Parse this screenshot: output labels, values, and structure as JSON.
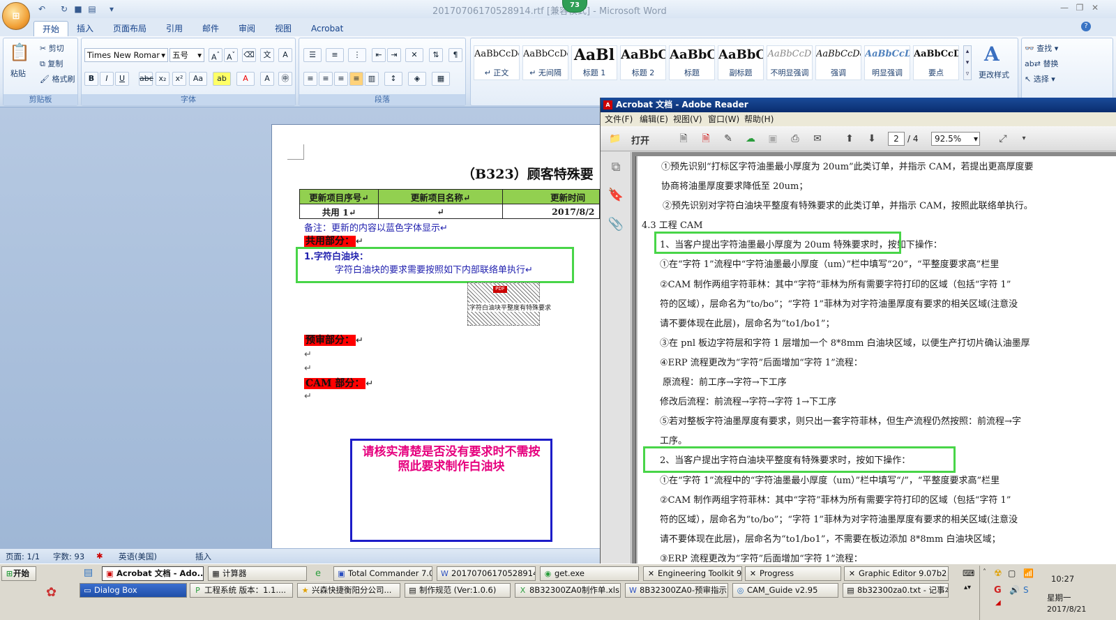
{
  "word": {
    "window_title": "20170706170528914.rtf [兼容模式] - Microsoft Word",
    "counter_badge": "73",
    "tabs": [
      "开始",
      "插入",
      "页面布局",
      "引用",
      "邮件",
      "审阅",
      "视图",
      "Acrobat"
    ],
    "clipboard": {
      "paste": "粘贴",
      "cut": "剪切",
      "copy": "复制",
      "format_painter": "格式刷",
      "label": "剪贴板"
    },
    "font": {
      "name": "Times New Romar",
      "size": "五号",
      "label": "字体"
    },
    "paragraph_label": "段落",
    "styles": [
      {
        "sample": "AaBbCcDc",
        "name": "↵ 正文"
      },
      {
        "sample": "AaBbCcDc",
        "name": "↵ 无间隔"
      },
      {
        "sample": "AaBl",
        "name": "标题 1"
      },
      {
        "sample": "AaBbC",
        "name": "标题 2"
      },
      {
        "sample": "AaBbC",
        "name": "标题"
      },
      {
        "sample": "AaBbC",
        "name": "副标题"
      },
      {
        "sample": "AaBbCcD",
        "name": "不明显强调"
      },
      {
        "sample": "AaBbCcDc",
        "name": "强调"
      },
      {
        "sample": "AaBbCcD",
        "name": "明显强调"
      },
      {
        "sample": "AaBbCcD",
        "name": "要点"
      }
    ],
    "change_styles": "更改样式",
    "editing": {
      "find": "查找",
      "replace": "替换",
      "select": "选择"
    },
    "doc": {
      "heading": "（B323）顾客特殊要",
      "table_headers": [
        "更新项目序号↵",
        "更新项目名称↵",
        "更新时间"
      ],
      "table_row": [
        "共用 1↵",
        "↵",
        "2017/8/2"
      ],
      "note": "备注：更新的内容以蓝色字体显示↵",
      "common_section": "共用部分：",
      "item_title": "1.字符白油块：",
      "item_body": "字符白油块的要求需要按照如下内部联络单执行↵",
      "embedded_caption": "字符白油块平整度有特殊要求",
      "pre_review_section": "预审部分：",
      "cam_section": "CAM 部分：",
      "pilcrow": "↵",
      "blue_box_text": "请核实清楚是否没有要求时不需按照此要求制作白油块"
    },
    "status": {
      "page": "页面: 1/1",
      "words": "字数: 93",
      "language": "英语(美国)",
      "mode": "插入"
    }
  },
  "reader": {
    "title": "Acrobat 文档 - Adobe Reader",
    "menu": [
      "文件(F)",
      "编辑(E)",
      "视图(V)",
      "窗口(W)",
      "帮助(H)"
    ],
    "open": "打开",
    "page_current": "2",
    "page_total": "/ 4",
    "zoom": "92.5%",
    "lines": [
      "①预先识别“打标区字符油墨最小厚度为 20um”此类订单，并指示 CAM，若提出更高厚度要",
      "协商将油墨厚度要求降低至 20um；",
      "②预先识别对字符白油块平整度有特殊要求的此类订单，并指示 CAM，按照此联络单执行。",
      "4.3 工程 CAM",
      "1、当客户提出字符油墨最小厚度为 20um 特殊要求时，按如下操作：",
      "①在“字符 1”流程中“字符油墨最小厚度（um）”栏中填写“20”，“平整度要求高”栏里",
      "②CAM 制作两组字符菲林：其中“字符”菲林为所有需要字符打印的区域（包括“字符 1”",
      "符的区域），层命名为“to/bo”；“字符 1”菲林为对字符油墨厚度有要求的相关区域(注意没",
      "请不要体现在此层)，层命名为“to1/bo1”；",
      "③在 pnl 板边字符层和字符 1 层增加一个 8*8mm 白油块区域，以便生产打切片确认油墨厚",
      "④ERP 流程更改为“字符”后面增加“字符 1”流程：",
      "原流程：前工序→字符→下工序",
      "修改后流程：前流程→字符→字符 1→下工序",
      "⑤若对整板字符油墨厚度有要求，则只出一套字符菲林，但生产流程仍然按照：前流程→字",
      "工序。",
      "2、当客户提出字符白油块平整度有特殊要求时，按如下操作：",
      "①在“字符 1”流程中的“字符油墨最小厚度（um）”栏中填写“/”，“平整度要求高”栏里",
      "②CAM 制作两组字符菲林：其中“字符”菲林为所有需要字符打印的区域（包括“字符 1”",
      "符的区域），层命名为“to/bo”；“字符 1”菲林为对字符油墨厚度有要求的相关区域(注意没",
      "请不要体现在此层)，层命名为“to1/bo1”，不需要在板边添加 8*8mm 白油块区域；",
      "③ERP 流程更改为“字符”后面增加“字符 1”流程："
    ]
  },
  "taskbar": {
    "start": "开始",
    "row1": [
      "Acrobat 文档 - Ado...",
      "计算器",
      "Total Commander 7.0 ...",
      "20170706170528914....",
      "get.exe",
      "Engineering Toolkit 9.0...",
      "Progress",
      "Graphic Editor 9.07b2 ..."
    ],
    "row2": [
      "Dialog Box",
      "工程系统  版本：1.1....",
      "兴森快捷衡阳分公司...",
      "制作规范 (Ver:1.0.6)",
      "8B32300ZA0制作单.xls ...",
      "8B32300ZA0-预审指示...",
      "CAM_Guide v2.95",
      "8b32300za0.txt - 记事本"
    ],
    "time": "10:27",
    "weekday": "星期一",
    "date": "2017/8/21"
  },
  "colors": {
    "highlight_red": "#ff0000",
    "table_header_green": "#92d050",
    "callout_green": "#48d548",
    "callout_blue": "#1c1cc8",
    "callout_text": "#e6007e"
  }
}
